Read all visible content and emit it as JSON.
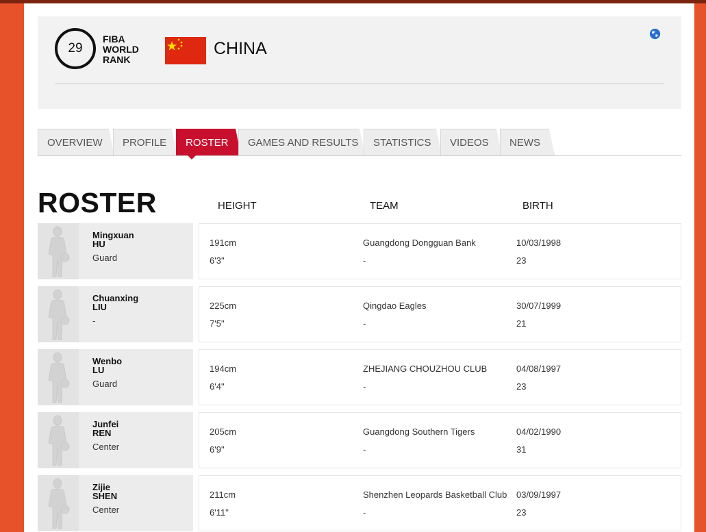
{
  "header": {
    "rank": "29",
    "rank_label_line1": "FIBA",
    "rank_label_line2": "WORLD",
    "rank_label_line3": "RANK",
    "country": "CHINA",
    "flag_color": "#de2910",
    "star_color": "#ffde00"
  },
  "tabs": [
    {
      "label": "OVERVIEW",
      "active": false
    },
    {
      "label": "PROFILE",
      "active": false
    },
    {
      "label": "ROSTER",
      "active": true
    },
    {
      "label": "GAMES AND RESULTS",
      "active": false
    },
    {
      "label": "STATISTICS",
      "active": false
    },
    {
      "label": "VIDEOS",
      "active": false
    },
    {
      "label": "NEWS",
      "active": false
    }
  ],
  "roster": {
    "title": "ROSTER",
    "columns": {
      "height": "HEIGHT",
      "team": "TEAM",
      "birth": "BIRTH"
    },
    "players": [
      {
        "first": "Mingxuan",
        "last": "HU",
        "position": "Guard",
        "height_cm": "191cm",
        "height_ft": "6'3\"",
        "team": "Guangdong Dongguan Bank",
        "team2": "-",
        "birth": "10/03/1998",
        "age": "23"
      },
      {
        "first": "Chuanxing",
        "last": "LIU",
        "position": "-",
        "height_cm": "225cm",
        "height_ft": "7'5\"",
        "team": "Qingdao Eagles",
        "team2": "-",
        "birth": "30/07/1999",
        "age": "21"
      },
      {
        "first": "Wenbo",
        "last": "LU",
        "position": "Guard",
        "height_cm": "194cm",
        "height_ft": "6'4\"",
        "team": "ZHEJIANG CHOUZHOU CLUB",
        "team2": "-",
        "birth": "04/08/1997",
        "age": "23"
      },
      {
        "first": "Junfei",
        "last": "REN",
        "position": "Center",
        "height_cm": "205cm",
        "height_ft": "6'9\"",
        "team": "Guangdong Southern Tigers",
        "team2": "-",
        "birth": "04/02/1990",
        "age": "31"
      },
      {
        "first": "Zijie",
        "last": "SHEN",
        "position": "Center",
        "height_cm": "211cm",
        "height_ft": "6'11\"",
        "team": "Shenzhen Leopards Basketball Club",
        "team2": "-",
        "birth": "03/09/1997",
        "age": "23"
      }
    ]
  },
  "icons": {
    "globe": "globe-icon",
    "player_placeholder": "player-silhouette-icon"
  }
}
